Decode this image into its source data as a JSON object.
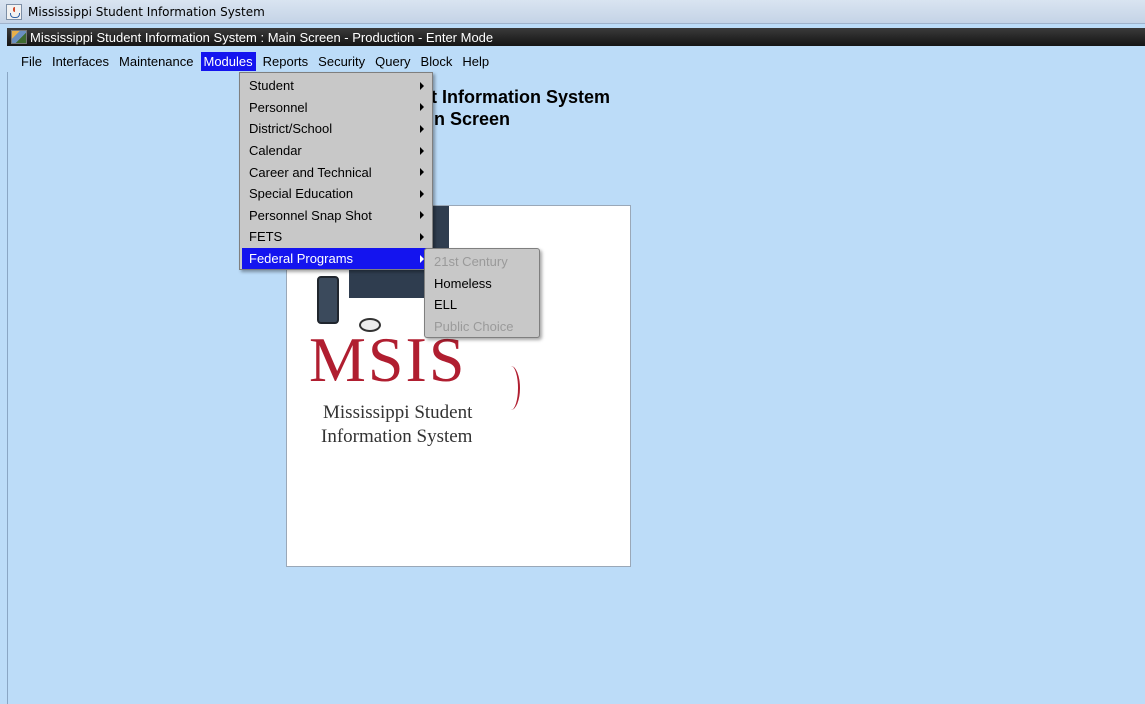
{
  "outer_window": {
    "title": "Mississippi Student Information System"
  },
  "inner_window": {
    "title": "Mississippi Student Information System : Main Screen  -  Production  -  Enter Mode"
  },
  "menubar": {
    "items": [
      "File",
      "Interfaces",
      "Maintenance",
      "Modules",
      "Reports",
      "Security",
      "Query",
      "Block",
      "Help"
    ],
    "active": "Modules"
  },
  "modules_menu": {
    "items": [
      "Student",
      "Personnel",
      "District/School",
      "Calendar",
      "Career and Technical",
      "Special Education",
      "Personnel Snap Shot",
      "FETS",
      "Federal Programs"
    ],
    "selected": "Federal Programs"
  },
  "federal_submenu": {
    "items": [
      "21st Century",
      "Homeless",
      "ELL",
      "Public Choice"
    ],
    "disabled": [
      "21st Century",
      "Public Choice"
    ]
  },
  "main": {
    "heading_line1_visible": "nt Information System",
    "heading_line2_visible": "n Screen"
  },
  "logo": {
    "acronym": "MSIS",
    "line1": "Mississippi Student",
    "line2": "Information System"
  },
  "colors": {
    "background": "#bcdcf8",
    "menu_highlight": "#1414ef",
    "logo_red": "#b01e30"
  }
}
